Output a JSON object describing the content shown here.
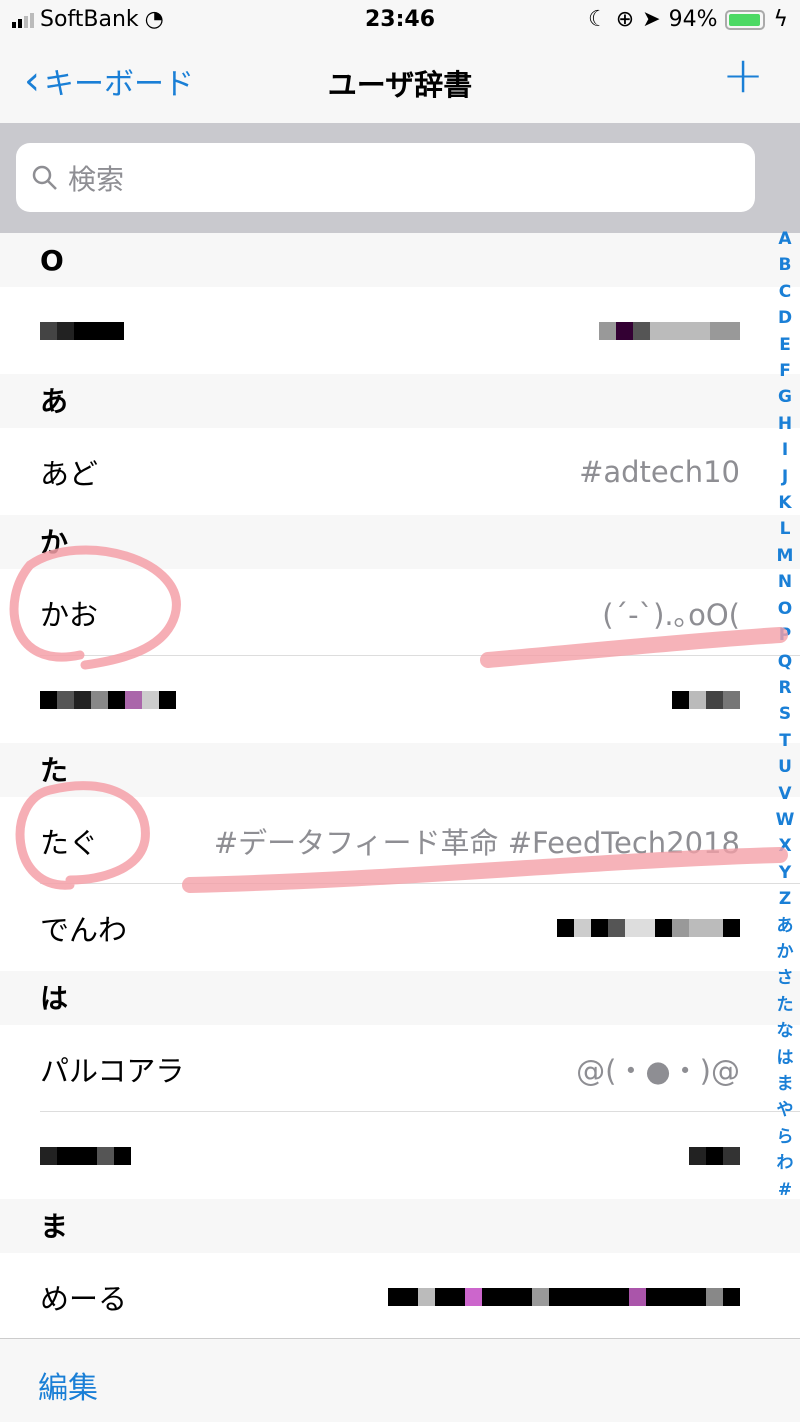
{
  "status": {
    "carrier": "SoftBank",
    "time": "23:46",
    "battery": "94%",
    "battery_level": 0.94
  },
  "nav": {
    "back_label": "キーボード",
    "title": "ユーザ辞書",
    "add_icon": "plus-icon"
  },
  "search": {
    "placeholder": "検索"
  },
  "sections": [
    {
      "header": "O",
      "rows": [
        {
          "word": "",
          "reading": "",
          "redacted": true
        }
      ]
    },
    {
      "header": "あ",
      "rows": [
        {
          "word": "あど",
          "reading": "#adtech10"
        }
      ]
    },
    {
      "header": "か",
      "rows": [
        {
          "word": "かお",
          "reading": "(´-`).｡oO("
        },
        {
          "word": "",
          "reading": "",
          "redacted": true
        }
      ]
    },
    {
      "header": "た",
      "rows": [
        {
          "word": "たぐ",
          "reading": "#データフィード革命 #FeedTech2018"
        },
        {
          "word": "でんわ",
          "reading": "",
          "redacted": true
        }
      ]
    },
    {
      "header": "は",
      "rows": [
        {
          "word": "パルコアラ",
          "reading": "@(・●・)@"
        },
        {
          "word": "",
          "reading": "",
          "redacted": true
        }
      ]
    },
    {
      "header": "ま",
      "rows": [
        {
          "word": "めーる",
          "reading": "",
          "redacted": true
        }
      ]
    }
  ],
  "index": [
    "A",
    "B",
    "C",
    "D",
    "E",
    "F",
    "G",
    "H",
    "I",
    "J",
    "K",
    "L",
    "M",
    "N",
    "O",
    "P",
    "Q",
    "R",
    "S",
    "T",
    "U",
    "V",
    "W",
    "X",
    "Y",
    "Z",
    "あ",
    "か",
    "さ",
    "た",
    "な",
    "は",
    "ま",
    "や",
    "ら",
    "わ",
    "#"
  ],
  "toolbar": {
    "edit_label": "編集"
  },
  "colors": {
    "accent": "#1a7fd6",
    "annotation": "#f4a0a8"
  }
}
